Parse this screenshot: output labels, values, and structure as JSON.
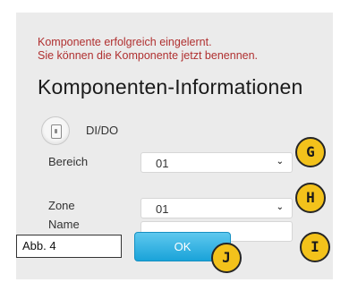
{
  "messages": {
    "success_line1": "Komponente erfolgreich eingelernt.",
    "success_line2": "Sie können die Komponente jetzt benennen."
  },
  "title": "Komponenten-Informationen",
  "device": {
    "icon": "switch-icon",
    "label": "DI/DO"
  },
  "form": {
    "bereich_label": "Bereich",
    "bereich_value": "01",
    "zone_label": "Zone",
    "zone_value": "01",
    "name_label": "Name",
    "name_value": ""
  },
  "ok_label": "OK",
  "badges": {
    "g": "G",
    "h": "H",
    "i": "I",
    "j": "J"
  },
  "caption": "Abb. 4",
  "colors": {
    "message": "#b03030",
    "ok_button": "#1aa3d9",
    "badge": "#f3c21b"
  }
}
